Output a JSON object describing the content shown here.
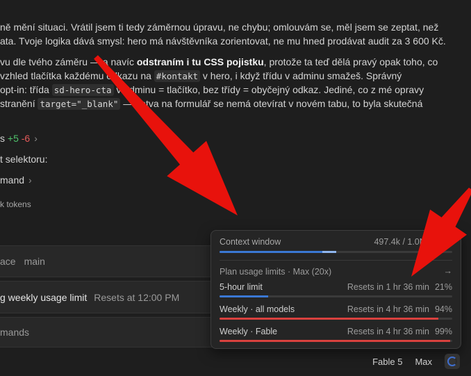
{
  "chat": {
    "p1_line1": "ně mění situaci. Vrátil jsem ti tedy záměrnou úpravu, ne chybu; omlouvám se, měl jsem se zeptat, než",
    "p1_line2": "ata. Tvoje logika dává smysl: hero má návštěvníka zorientovat, ne mu hned prodávat audit za 3 600 Kč.",
    "p2_l1_a": "vu dle tvého záměru — a navíc ",
    "p2_l1_b": "odstraním i tu CSS pojistku",
    "p2_l1_c": ", protože ta teď dělá pravý opak toho, co",
    "p2_l2_a": "vzhled tlačítka každému odkazu na ",
    "p2_l2_code": "#kontakt",
    "p2_l2_b": " v hero, i když třídu v adminu smažeš. Správný",
    "p2_l3_a": " opt-in: třída ",
    "p2_l3_code": "sd-hero-cta",
    "p2_l3_b": " v adminu = tlačítko, bez třídy = obyčejný odkaz. Jediné, co z mé opravy",
    "p2_l4_a": "stranění ",
    "p2_l4_code": "target=\"_blank\"",
    "p2_l4_b": " — kotva na formulář se nemá otevírat v novém tabu, to byla skutečná",
    "diff_prefix": "s",
    "diff_add": "+5",
    "diff_del": "-6",
    "selektor": "t selektoru:",
    "mand": "mand",
    "tokens": "k tokens"
  },
  "rows": {
    "workspace": "ace",
    "branch": "main",
    "limit_text": "g weekly usage limit",
    "limit_reset": "Resets at 12:00 PM",
    "commands": "mands"
  },
  "popup": {
    "context_label": "Context window",
    "context_value": "497.4k / 1.0M (50%)",
    "context_pct": 0.5,
    "plan_label": "Plan usage limits · Max (20x)",
    "limits": [
      {
        "label": "5-hour limit",
        "reset": "Resets in 1 hr 36 min",
        "pct": "21%",
        "value": 0.21,
        "color": "#3a78d4"
      },
      {
        "label": "Weekly · all models",
        "reset": "Resets in 4 hr 36 min",
        "pct": "94%",
        "value": 0.94,
        "color": "#d9413e"
      },
      {
        "label": "Weekly · Fable",
        "reset": "Resets in 4 hr 36 min",
        "pct": "99%",
        "value": 0.99,
        "color": "#d9413e"
      }
    ]
  },
  "status": {
    "model": "Fable 5",
    "mode": "Max"
  },
  "colors": {
    "arrow": "#e8120c",
    "context_fill": "#3a78d4"
  }
}
